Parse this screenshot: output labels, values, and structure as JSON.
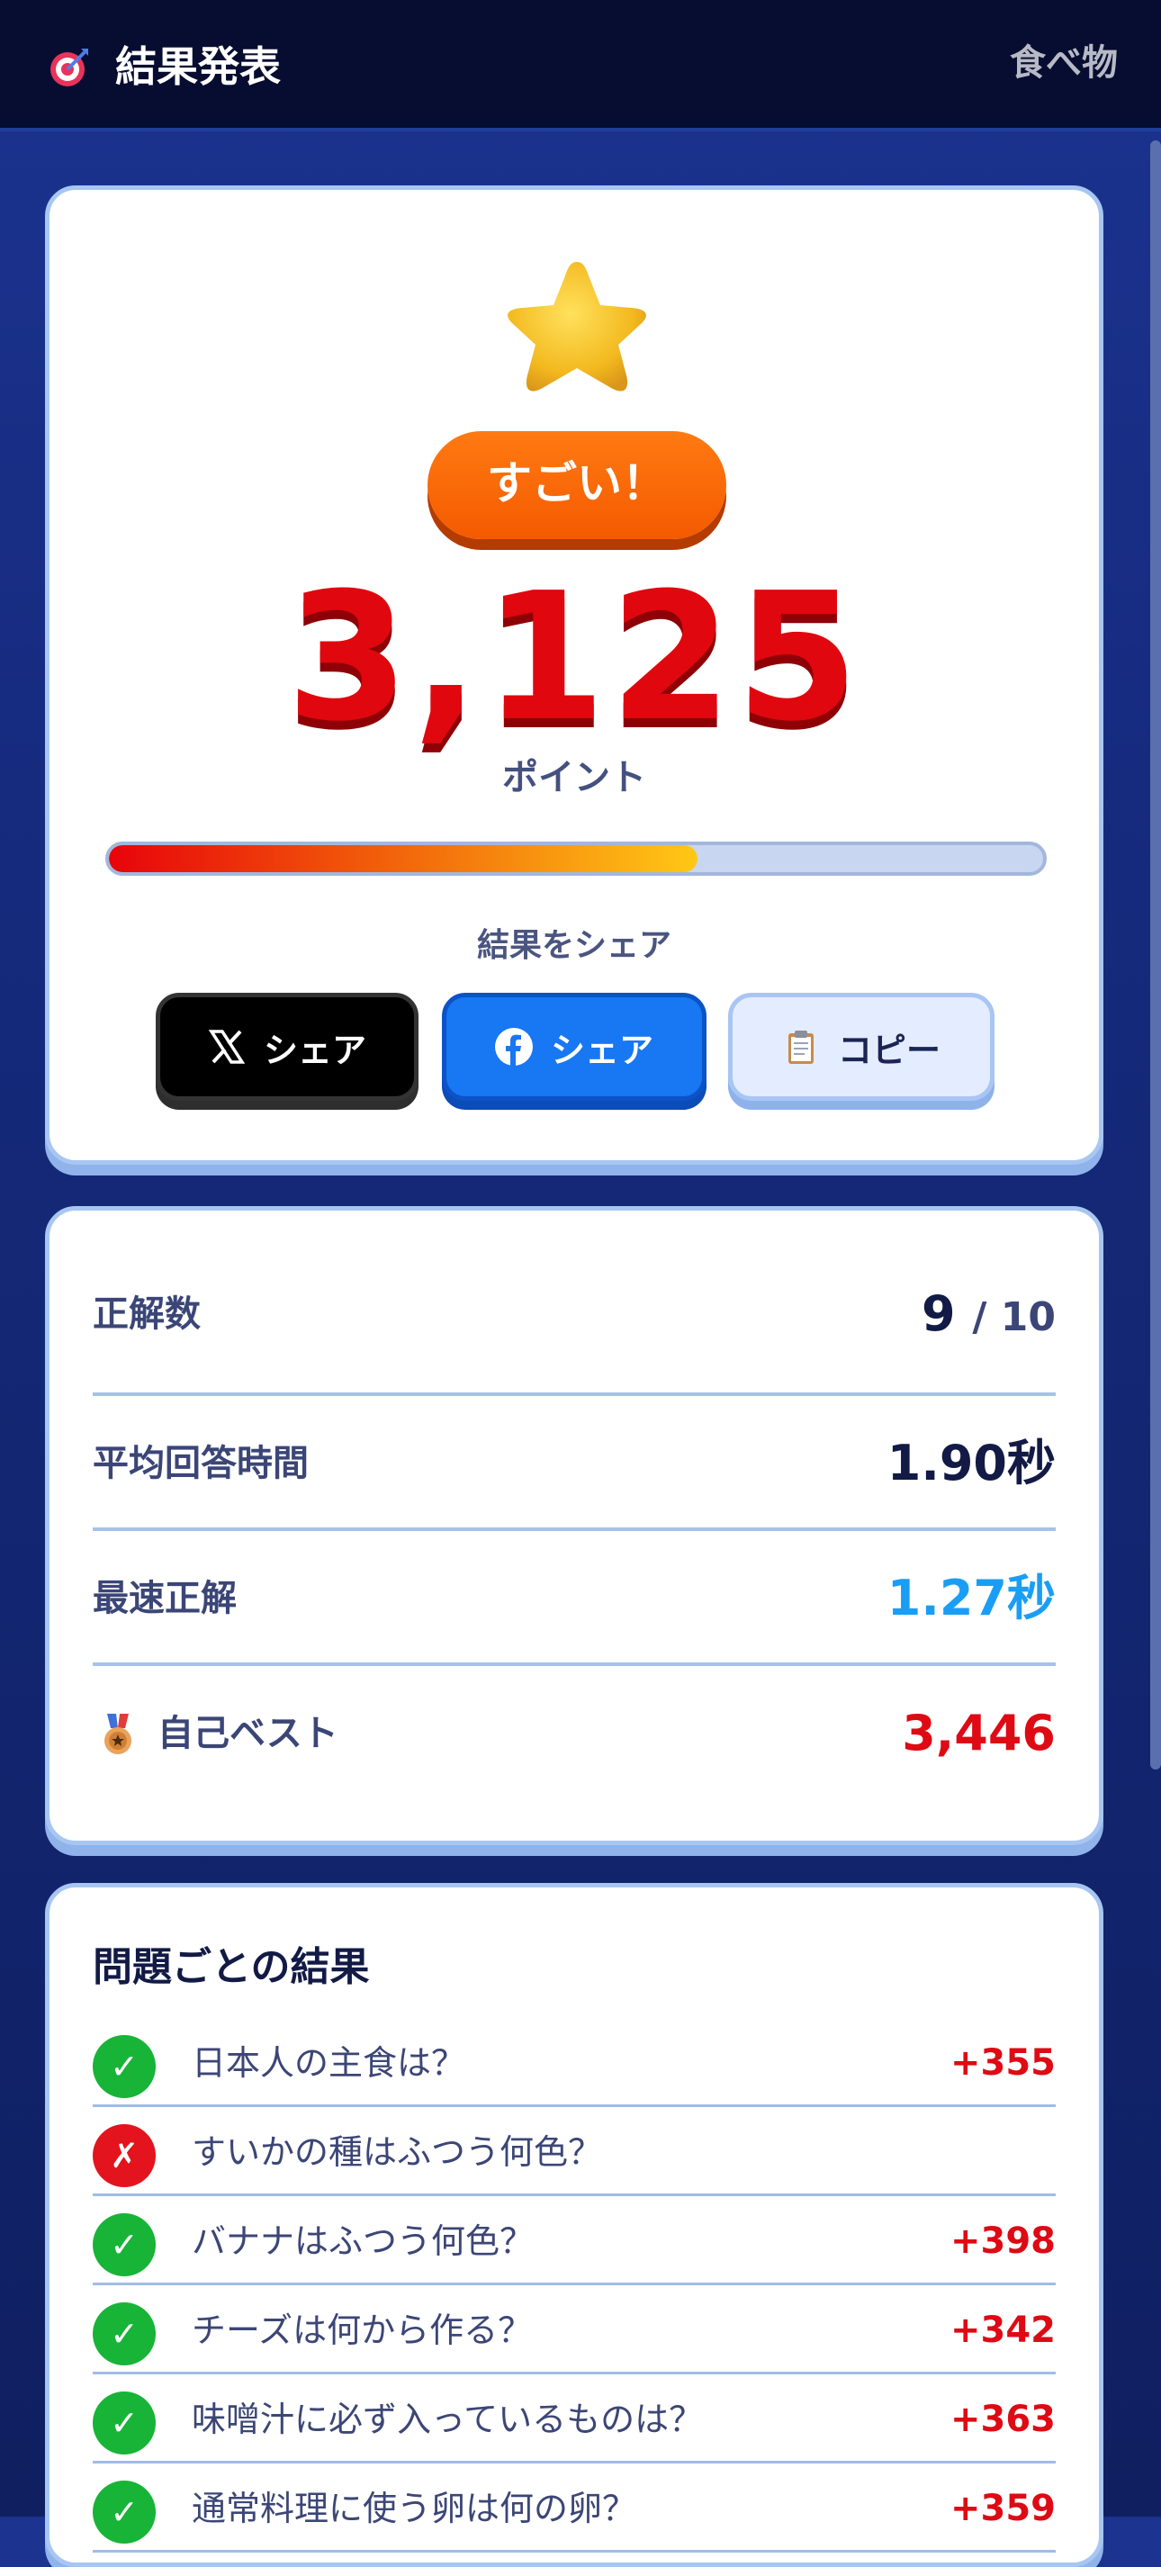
{
  "header": {
    "title": "結果発表",
    "category": "食べ物",
    "icon": "target-icon"
  },
  "result": {
    "badge": "すごい！",
    "score": "3,125",
    "score_unit": "ポイント",
    "progress_fraction": 0.63,
    "share_label": "結果をシェア",
    "buttons": {
      "x_share": "シェア",
      "facebook_share": "シェア",
      "copy": "コピー"
    }
  },
  "stats": {
    "correct_label": "正解数",
    "correct_value": "9",
    "correct_total": "/ 10",
    "avg_time_label": "平均回答時間",
    "avg_time_value": "1.90秒",
    "fastest_label": "最速正解",
    "fastest_value": "1.27秒",
    "best_label": "自己ベスト",
    "best_value": "3,446",
    "colors": {
      "fastest": "#1a9ef5",
      "best": "#de0a14"
    }
  },
  "questions": {
    "title": "問題ごとの結果",
    "items": [
      {
        "correct": true,
        "mark": "✓",
        "text": "日本人の主食は？",
        "points": "+355"
      },
      {
        "correct": false,
        "mark": "✗",
        "text": "すいかの種はふつう何色？",
        "points": ""
      },
      {
        "correct": true,
        "mark": "✓",
        "text": "バナナはふつう何色？",
        "points": "+398"
      },
      {
        "correct": true,
        "mark": "✓",
        "text": "チーズは何から作る？",
        "points": "+342"
      },
      {
        "correct": true,
        "mark": "✓",
        "text": "味噌汁に必ず入っているものは？",
        "points": "+363"
      },
      {
        "correct": true,
        "mark": "✓",
        "text": "通常料理に使う卵は何の卵？",
        "points": "+359"
      }
    ]
  }
}
